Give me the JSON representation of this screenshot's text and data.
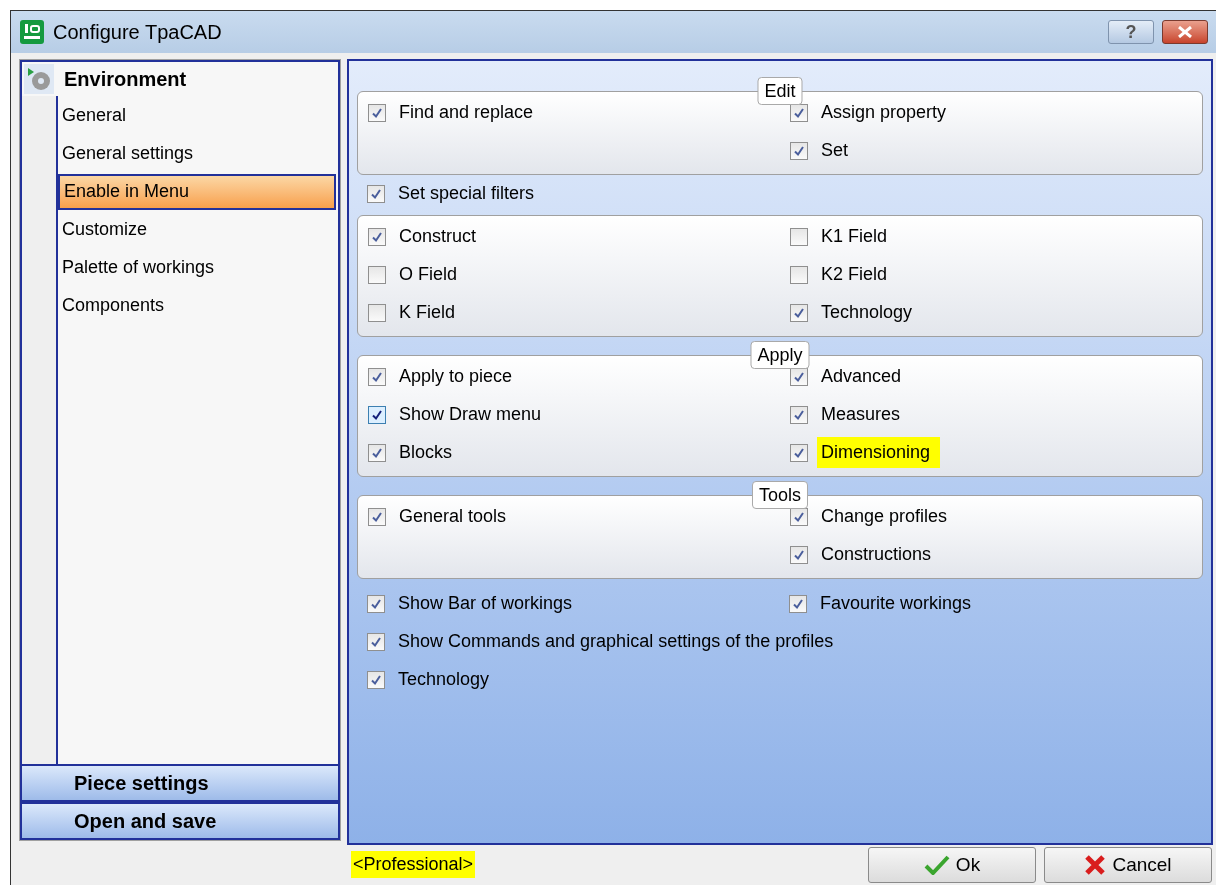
{
  "window": {
    "title": "Configure TpaCAD",
    "buttons": [
      "?"
    ]
  },
  "sidebar": {
    "header": {
      "label": "Environment"
    },
    "items": [
      {
        "label": "General",
        "selected": false
      },
      {
        "label": "General settings",
        "selected": false
      },
      {
        "label": "Enable in Menu",
        "selected": true
      },
      {
        "label": "Customize",
        "selected": false
      },
      {
        "label": "Palette of workings",
        "selected": false
      },
      {
        "label": "Components",
        "selected": false
      }
    ],
    "sections": [
      "Piece settings",
      "Open and save"
    ]
  },
  "sections": [
    {
      "kind": "box",
      "title": "Edit",
      "left": [
        {
          "label": "Find and replace",
          "checked": true,
          "focused": false,
          "highlighted": false
        }
      ],
      "right": [
        {
          "label": "Assign property",
          "checked": true,
          "focused": false,
          "highlighted": false
        },
        {
          "label": "Set",
          "checked": true,
          "focused": false,
          "highlighted": false
        }
      ]
    },
    {
      "kind": "line",
      "item": {
        "label": "Set special filters",
        "checked": true,
        "focused": false,
        "highlighted": false
      }
    },
    {
      "kind": "box",
      "left": [
        {
          "label": "Construct",
          "checked": true,
          "focused": false,
          "highlighted": false
        },
        {
          "label": "O Field",
          "checked": false,
          "focused": false,
          "highlighted": false
        },
        {
          "label": "K Field",
          "checked": false,
          "focused": false,
          "highlighted": false
        }
      ],
      "right": [
        {
          "label": "K1 Field",
          "checked": false,
          "focused": false,
          "highlighted": false
        },
        {
          "label": "K2 Field",
          "checked": false,
          "focused": false,
          "highlighted": false
        },
        {
          "label": "Technology",
          "checked": true,
          "focused": false,
          "highlighted": false
        }
      ]
    },
    {
      "kind": "box",
      "title": "Apply",
      "left": [
        {
          "label": "Apply to piece",
          "checked": true,
          "focused": false,
          "highlighted": false
        },
        {
          "label": "Show Draw menu",
          "checked": true,
          "focused": true,
          "highlighted": false
        },
        {
          "label": "Blocks",
          "checked": true,
          "focused": false,
          "highlighted": false
        }
      ],
      "right": [
        {
          "label": "Advanced",
          "checked": true,
          "focused": false,
          "highlighted": false
        },
        {
          "label": "Measures",
          "checked": true,
          "focused": false,
          "highlighted": false
        },
        {
          "label": "Dimensioning",
          "checked": true,
          "focused": false,
          "highlighted": true
        }
      ]
    },
    {
      "kind": "box",
      "title": "Tools",
      "left": [
        {
          "label": "General tools",
          "checked": true,
          "focused": false,
          "highlighted": false
        }
      ],
      "right": [
        {
          "label": "Change profiles",
          "checked": true,
          "focused": false,
          "highlighted": false
        },
        {
          "label": "Constructions",
          "checked": true,
          "focused": false,
          "highlighted": false
        }
      ]
    },
    {
      "kind": "row",
      "left": [
        {
          "label": "Show Bar of workings",
          "checked": true,
          "focused": false,
          "highlighted": false
        }
      ],
      "right": [
        {
          "label": "Favourite workings",
          "checked": true,
          "focused": false,
          "highlighted": false
        }
      ]
    },
    {
      "kind": "line",
      "item": {
        "label": "Show Commands and graphical settings of the profiles",
        "checked": true,
        "focused": false,
        "highlighted": false
      }
    },
    {
      "kind": "line",
      "item": {
        "label": "Technology",
        "checked": true,
        "focused": false,
        "highlighted": false
      }
    }
  ],
  "footer": {
    "edition": "<Professional>",
    "buttons": [
      {
        "label": "Ok",
        "kind": "ok"
      },
      {
        "label": "Cancel",
        "kind": "cancel"
      }
    ]
  }
}
